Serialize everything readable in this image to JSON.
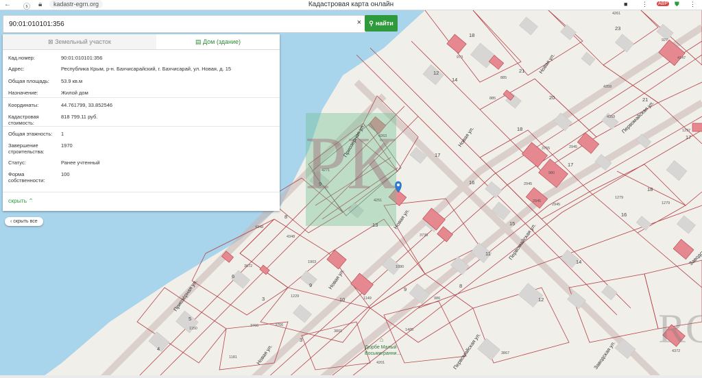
{
  "browser": {
    "url": "kadastr-egrn.org",
    "page_title": "Кадастровая карта онлайн",
    "extensions": [
      "ABP"
    ]
  },
  "search": {
    "value": "90:01:010101:356",
    "clear_symbol": "×",
    "find_label": "найти"
  },
  "panel": {
    "tab_land": "Земельный участок",
    "tab_house": "Дом (здание)",
    "rows": [
      {
        "key": "Кад.номер:",
        "value": "90:01:010101:356"
      },
      {
        "key": "Адрес:",
        "value": "Республика Крым, р-н. Бахчисарайский, г. Бахчисарай, ул. Новая, д. 15"
      },
      {
        "key": "Общая площадь:",
        "value": "53.9 кв.м"
      },
      {
        "key": "Назначение:",
        "value": "Жилой дом"
      },
      {
        "key": "Координаты:",
        "value": "44.761799, 33.852546"
      },
      {
        "key": "Кадастровая стоимость:",
        "value": "818 799.11 руб."
      },
      {
        "key": "Общая этажность:",
        "value": "1"
      },
      {
        "key": "Завершение строительства:",
        "value": "1970"
      },
      {
        "key": "Статус:",
        "value": "Ранее учтенный"
      },
      {
        "key": "Форма собственности:",
        "value": "100"
      }
    ],
    "hide_label": "скрыть"
  },
  "collapse_all": "скрыть все",
  "streets": [
    {
      "name": "Новая ул.",
      "id": "novaya1"
    },
    {
      "name": "Новая ул.",
      "id": "novaya2"
    },
    {
      "name": "Новая ул.",
      "id": "novaya3"
    },
    {
      "name": "Новая ул.",
      "id": "novaya4"
    },
    {
      "name": "Новая ул.",
      "id": "novaya5"
    },
    {
      "name": "Приозёрная ул.",
      "id": "priozer1"
    },
    {
      "name": "Приозерная ул.",
      "id": "priozer2"
    },
    {
      "name": "Первомайская ул.",
      "id": "perv1"
    },
    {
      "name": "Первомайская ул.",
      "id": "perv2"
    },
    {
      "name": "Первомайская ул.",
      "id": "perv3"
    },
    {
      "name": "Заводская ул.",
      "id": "zavod1"
    },
    {
      "name": "Заводская ул.",
      "id": "zavod2"
    }
  ],
  "poi": {
    "name1": "Дюрбе Малый",
    "name2": "Восьмигранни..."
  },
  "parcel_numbers": [
    "973",
    "885",
    "885",
    "4359",
    "4359",
    "1297",
    "4263",
    "3755",
    "2945",
    "2945",
    "980",
    "2945",
    "2945",
    "1279",
    "1279",
    "4271",
    "4251",
    "4348",
    "4348",
    "3738",
    "3672",
    "1903",
    "1030",
    "1229",
    "986",
    "1149",
    "3766",
    "3766",
    "1150",
    "1181",
    "3801",
    "1485",
    "4201",
    "3867",
    "4372",
    "4147",
    "4261",
    "927"
  ],
  "house_numbers": [
    "18",
    "12",
    "14",
    "21",
    "23",
    "20",
    "21",
    "17",
    "18",
    "17",
    "16",
    "17",
    "15",
    "18",
    "16",
    "8",
    "9",
    "13",
    "11",
    "14",
    "12",
    "5",
    "4",
    "9",
    "10",
    "8",
    "6",
    "3",
    "3",
    "9"
  ],
  "colors": {
    "water": "#a8d4ec",
    "parcel_line": "#b5424a",
    "building_red": "#e58890",
    "building_gray": "#d8d6d4",
    "accent": "#2e9a3b"
  }
}
